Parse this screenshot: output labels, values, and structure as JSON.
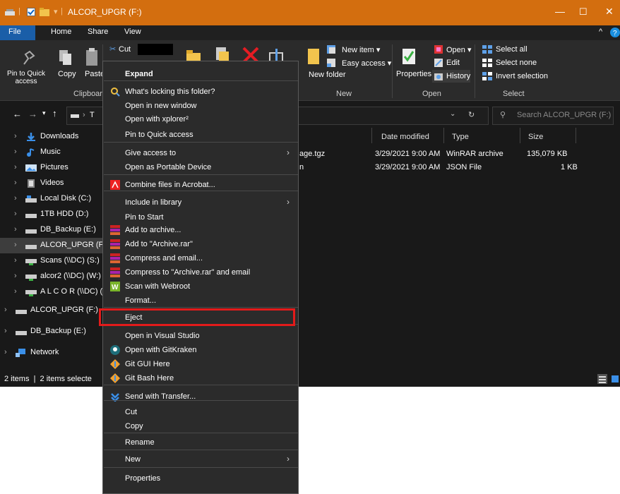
{
  "window": {
    "title": "ALCOR_UPGR (F:)",
    "menu": [
      "File",
      "Home",
      "Share",
      "View"
    ],
    "colors": {
      "titlebar": "#d36e0f",
      "background": "#191919",
      "highlight": "#e31b1b"
    }
  },
  "ribbon": {
    "pin_label": "Pin to Quick access",
    "copy_label": "Copy",
    "paste_label": "Paste",
    "cut_label": "Cut",
    "clipboard_group": "Clipboard",
    "new_item": "New item ▾",
    "easy_access": "Easy access ▾",
    "new_folder": "New folder",
    "new_group": "New",
    "properties": "Properties",
    "open": "Open ▾",
    "edit": "Edit",
    "history": "History",
    "open_group": "Open",
    "select_all": "Select all",
    "select_none": "Select none",
    "invert_selection": "Invert selection",
    "select_group": "Select"
  },
  "address": {
    "path_fragment": "T",
    "search_placeholder": "Search ALCOR_UPGR (F:)"
  },
  "nav": [
    {
      "label": "Downloads",
      "icon": "download-arrow-icon"
    },
    {
      "label": "Music",
      "icon": "music-note-icon"
    },
    {
      "label": "Pictures",
      "icon": "pictures-icon"
    },
    {
      "label": "Videos",
      "icon": "videos-icon"
    },
    {
      "label": "Local Disk (C:)",
      "icon": "drive-icon"
    },
    {
      "label": "1TB HDD (D:)",
      "icon": "drive-icon"
    },
    {
      "label": "DB_Backup (E:)",
      "icon": "drive-icon"
    },
    {
      "label": "ALCOR_UPGR (F:)",
      "icon": "drive-icon"
    },
    {
      "label": "Scans (\\\\DC) (S:)",
      "icon": "network-drive-icon"
    },
    {
      "label": "alcor2 (\\\\DC) (W:)",
      "icon": "network-drive-icon"
    },
    {
      "label": "A L C O R (\\\\DC) (Z",
      "icon": "network-drive-icon"
    },
    {
      "label": "ALCOR_UPGR (F:)",
      "icon": "drive-icon"
    },
    {
      "label": "DB_Backup (E:)",
      "icon": "drive-icon"
    },
    {
      "label": "Network",
      "icon": "network-icon"
    }
  ],
  "columns": [
    "Date modified",
    "Type",
    "Size"
  ],
  "files": [
    {
      "name": "age.tgz",
      "date": "3/29/2021 9:00 AM",
      "type": "WinRAR archive",
      "size": "135,079 KB"
    },
    {
      "name": "n",
      "date": "3/29/2021 9:00 AM",
      "type": "JSON File",
      "size": "1 KB"
    }
  ],
  "status": "2 items  |  2 items selecte",
  "context_menu": [
    {
      "label": "Expand",
      "bold": true
    },
    {
      "label": "What's locking this folder?",
      "icon": "lock-search-icon"
    },
    {
      "label": "Open in new window"
    },
    {
      "label": "Open with xplorer²"
    },
    {
      "label": "Pin to Quick access"
    },
    {
      "label": "Give access to",
      "submenu": true
    },
    {
      "label": "Open as Portable Device"
    },
    {
      "label": "Combine files in Acrobat...",
      "icon": "acrobat-icon"
    },
    {
      "label": "Include in library",
      "submenu": true
    },
    {
      "label": "Pin to Start"
    },
    {
      "label": "Add to archive...",
      "icon": "winrar-icon"
    },
    {
      "label": "Add to \"Archive.rar\"",
      "icon": "winrar-icon"
    },
    {
      "label": "Compress and email...",
      "icon": "winrar-icon"
    },
    {
      "label": "Compress to \"Archive.rar\" and email",
      "icon": "winrar-icon"
    },
    {
      "label": "Scan with Webroot",
      "icon": "webroot-icon"
    },
    {
      "label": "Format..."
    },
    {
      "label": "Eject"
    },
    {
      "label": "Open in Visual Studio"
    },
    {
      "label": "Open with GitKraken",
      "icon": "gitkraken-icon"
    },
    {
      "label": "Git GUI Here",
      "icon": "git-icon"
    },
    {
      "label": "Git Bash Here",
      "icon": "git-icon"
    },
    {
      "label": "Send with Transfer...",
      "icon": "transfer-icon"
    },
    {
      "label": "Cut"
    },
    {
      "label": "Copy"
    },
    {
      "label": "Rename"
    },
    {
      "label": "New",
      "submenu": true
    },
    {
      "label": "Properties"
    }
  ]
}
